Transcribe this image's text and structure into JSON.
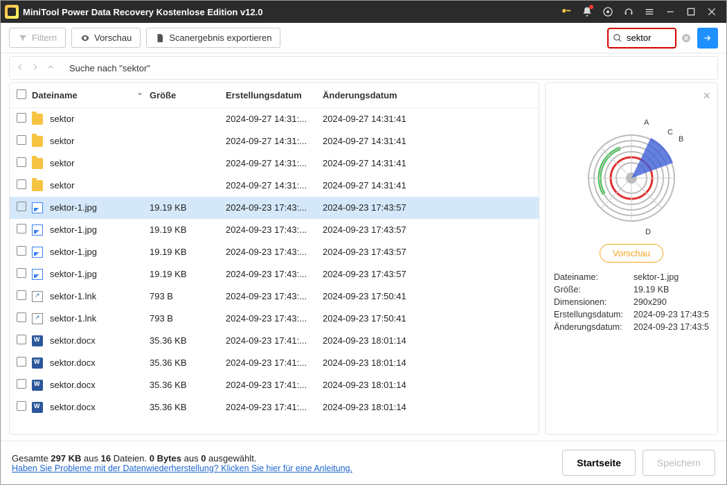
{
  "title": "MiniTool Power Data Recovery Kostenlose Edition v12.0",
  "toolbar": {
    "filter": "Filtern",
    "preview": "Vorschau",
    "export": "Scanergebnis exportieren"
  },
  "search": {
    "value": "sektor"
  },
  "breadcrumb": "Suche nach \"sektor\"",
  "columns": {
    "name": "Dateiname",
    "size": "Größe",
    "cdate": "Erstellungsdatum",
    "mdate": "Änderungsdatum"
  },
  "rows": [
    {
      "icon": "folder",
      "name": "sektor",
      "size": "",
      "cdate": "2024-09-27 14:31:...",
      "mdate": "2024-09-27 14:31:41",
      "selected": false
    },
    {
      "icon": "folder",
      "name": "sektor",
      "size": "",
      "cdate": "2024-09-27 14:31:...",
      "mdate": "2024-09-27 14:31:41",
      "selected": false
    },
    {
      "icon": "folder",
      "name": "sektor",
      "size": "",
      "cdate": "2024-09-27 14:31:...",
      "mdate": "2024-09-27 14:31:41",
      "selected": false
    },
    {
      "icon": "folder",
      "name": "sektor",
      "size": "",
      "cdate": "2024-09-27 14:31:...",
      "mdate": "2024-09-27 14:31:41",
      "selected": false
    },
    {
      "icon": "img",
      "name": "sektor-1.jpg",
      "size": "19.19 KB",
      "cdate": "2024-09-23 17:43:...",
      "mdate": "2024-09-23 17:43:57",
      "selected": true
    },
    {
      "icon": "img",
      "name": "sektor-1.jpg",
      "size": "19.19 KB",
      "cdate": "2024-09-23 17:43:...",
      "mdate": "2024-09-23 17:43:57",
      "selected": false
    },
    {
      "icon": "img",
      "name": "sektor-1.jpg",
      "size": "19.19 KB",
      "cdate": "2024-09-23 17:43:...",
      "mdate": "2024-09-23 17:43:57",
      "selected": false
    },
    {
      "icon": "img",
      "name": "sektor-1.jpg",
      "size": "19.19 KB",
      "cdate": "2024-09-23 17:43:...",
      "mdate": "2024-09-23 17:43:57",
      "selected": false
    },
    {
      "icon": "lnk",
      "name": "sektor-1.lnk",
      "size": "793 B",
      "cdate": "2024-09-23 17:43:...",
      "mdate": "2024-09-23 17:50:41",
      "selected": false
    },
    {
      "icon": "lnk",
      "name": "sektor-1.lnk",
      "size": "793 B",
      "cdate": "2024-09-23 17:43:...",
      "mdate": "2024-09-23 17:50:41",
      "selected": false
    },
    {
      "icon": "docx",
      "name": "sektor.docx",
      "size": "35.36 KB",
      "cdate": "2024-09-23 17:41:...",
      "mdate": "2024-09-23 18:01:14",
      "selected": false
    },
    {
      "icon": "docx",
      "name": "sektor.docx",
      "size": "35.36 KB",
      "cdate": "2024-09-23 17:41:...",
      "mdate": "2024-09-23 18:01:14",
      "selected": false
    },
    {
      "icon": "docx",
      "name": "sektor.docx",
      "size": "35.36 KB",
      "cdate": "2024-09-23 17:41:...",
      "mdate": "2024-09-23 18:01:14",
      "selected": false
    },
    {
      "icon": "docx",
      "name": "sektor.docx",
      "size": "35.36 KB",
      "cdate": "2024-09-23 17:41:...",
      "mdate": "2024-09-23 18:01:14",
      "selected": false
    }
  ],
  "preview": {
    "button": "Vorschau",
    "labels": {
      "name": "Dateiname:",
      "size": "Größe:",
      "dim": "Dimensionen:",
      "cdate": "Erstellungsdatum:",
      "mdate": "Änderungsdatum:"
    },
    "values": {
      "name": "sektor-1.jpg",
      "size": "19.19 KB",
      "dim": "290x290",
      "cdate": "2024-09-23 17:43:5",
      "mdate": "2024-09-23 17:43:5"
    },
    "chart_labels": [
      "A",
      "B",
      "C",
      "D"
    ]
  },
  "footer": {
    "stats_pre": "Gesamte ",
    "stats_kb": "297 KB",
    "stats_mid": " aus ",
    "stats_files": "16",
    "stats_mid2": " Dateien.  ",
    "stats_sel": "0 Bytes",
    "stats_mid3": " aus ",
    "stats_seln": "0",
    "stats_post": " ausgewählt.",
    "link": "Haben Sie Probleme mit der Datenwiederherstellung? Klicken Sie hier für eine Anleitung.",
    "home": "Startseite",
    "save": "Speichern"
  }
}
